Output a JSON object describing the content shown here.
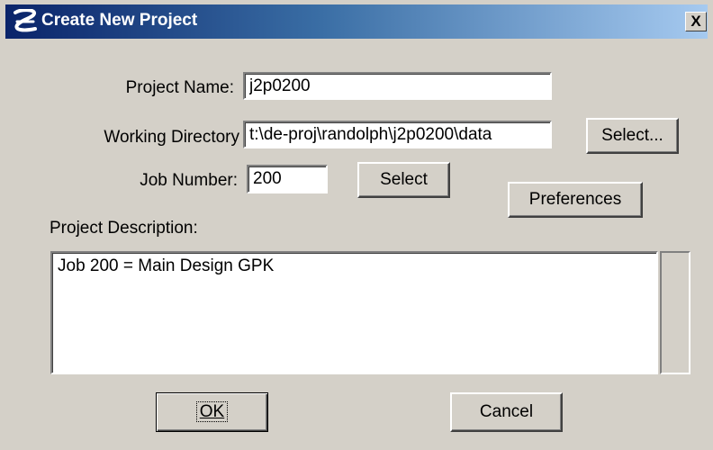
{
  "window": {
    "title": "Create New Project",
    "app_icon": "microstation-icon",
    "close_label": "X",
    "colors": {
      "title_bar_start": "#0a246a",
      "title_bar_end": "#a6caf0",
      "face": "#d4d0c8"
    }
  },
  "form": {
    "project_name": {
      "label": "Project Name:",
      "value": "j2p0200"
    },
    "working_directory": {
      "label": "Working Directory",
      "value": "t:\\de-proj\\randolph\\j2p0200\\data",
      "select_button": "Select..."
    },
    "job_number": {
      "label": "Job Number:",
      "value": "200",
      "select_button": "Select"
    },
    "preferences_button": "Preferences",
    "description": {
      "label": "Project Description:",
      "value": "Job 200 = Main Design GPK"
    }
  },
  "buttons": {
    "ok": "OK",
    "cancel": "Cancel"
  }
}
